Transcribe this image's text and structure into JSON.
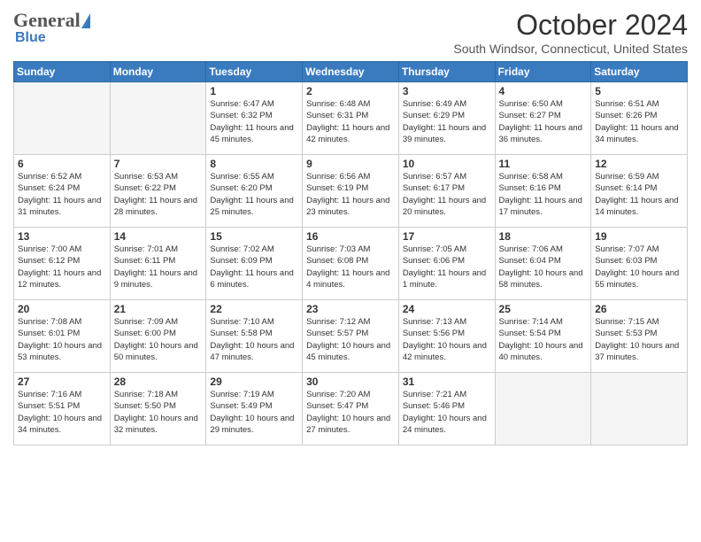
{
  "header": {
    "logo_general": "General",
    "logo_blue": "Blue",
    "month_title": "October 2024",
    "location": "South Windsor, Connecticut, United States"
  },
  "weekdays": [
    "Sunday",
    "Monday",
    "Tuesday",
    "Wednesday",
    "Thursday",
    "Friday",
    "Saturday"
  ],
  "weeks": [
    [
      {
        "num": "",
        "sunrise": "",
        "sunset": "",
        "daylight": ""
      },
      {
        "num": "",
        "sunrise": "",
        "sunset": "",
        "daylight": ""
      },
      {
        "num": "1",
        "sunrise": "Sunrise: 6:47 AM",
        "sunset": "Sunset: 6:32 PM",
        "daylight": "Daylight: 11 hours and 45 minutes."
      },
      {
        "num": "2",
        "sunrise": "Sunrise: 6:48 AM",
        "sunset": "Sunset: 6:31 PM",
        "daylight": "Daylight: 11 hours and 42 minutes."
      },
      {
        "num": "3",
        "sunrise": "Sunrise: 6:49 AM",
        "sunset": "Sunset: 6:29 PM",
        "daylight": "Daylight: 11 hours and 39 minutes."
      },
      {
        "num": "4",
        "sunrise": "Sunrise: 6:50 AM",
        "sunset": "Sunset: 6:27 PM",
        "daylight": "Daylight: 11 hours and 36 minutes."
      },
      {
        "num": "5",
        "sunrise": "Sunrise: 6:51 AM",
        "sunset": "Sunset: 6:26 PM",
        "daylight": "Daylight: 11 hours and 34 minutes."
      }
    ],
    [
      {
        "num": "6",
        "sunrise": "Sunrise: 6:52 AM",
        "sunset": "Sunset: 6:24 PM",
        "daylight": "Daylight: 11 hours and 31 minutes."
      },
      {
        "num": "7",
        "sunrise": "Sunrise: 6:53 AM",
        "sunset": "Sunset: 6:22 PM",
        "daylight": "Daylight: 11 hours and 28 minutes."
      },
      {
        "num": "8",
        "sunrise": "Sunrise: 6:55 AM",
        "sunset": "Sunset: 6:20 PM",
        "daylight": "Daylight: 11 hours and 25 minutes."
      },
      {
        "num": "9",
        "sunrise": "Sunrise: 6:56 AM",
        "sunset": "Sunset: 6:19 PM",
        "daylight": "Daylight: 11 hours and 23 minutes."
      },
      {
        "num": "10",
        "sunrise": "Sunrise: 6:57 AM",
        "sunset": "Sunset: 6:17 PM",
        "daylight": "Daylight: 11 hours and 20 minutes."
      },
      {
        "num": "11",
        "sunrise": "Sunrise: 6:58 AM",
        "sunset": "Sunset: 6:16 PM",
        "daylight": "Daylight: 11 hours and 17 minutes."
      },
      {
        "num": "12",
        "sunrise": "Sunrise: 6:59 AM",
        "sunset": "Sunset: 6:14 PM",
        "daylight": "Daylight: 11 hours and 14 minutes."
      }
    ],
    [
      {
        "num": "13",
        "sunrise": "Sunrise: 7:00 AM",
        "sunset": "Sunset: 6:12 PM",
        "daylight": "Daylight: 11 hours and 12 minutes."
      },
      {
        "num": "14",
        "sunrise": "Sunrise: 7:01 AM",
        "sunset": "Sunset: 6:11 PM",
        "daylight": "Daylight: 11 hours and 9 minutes."
      },
      {
        "num": "15",
        "sunrise": "Sunrise: 7:02 AM",
        "sunset": "Sunset: 6:09 PM",
        "daylight": "Daylight: 11 hours and 6 minutes."
      },
      {
        "num": "16",
        "sunrise": "Sunrise: 7:03 AM",
        "sunset": "Sunset: 6:08 PM",
        "daylight": "Daylight: 11 hours and 4 minutes."
      },
      {
        "num": "17",
        "sunrise": "Sunrise: 7:05 AM",
        "sunset": "Sunset: 6:06 PM",
        "daylight": "Daylight: 11 hours and 1 minute."
      },
      {
        "num": "18",
        "sunrise": "Sunrise: 7:06 AM",
        "sunset": "Sunset: 6:04 PM",
        "daylight": "Daylight: 10 hours and 58 minutes."
      },
      {
        "num": "19",
        "sunrise": "Sunrise: 7:07 AM",
        "sunset": "Sunset: 6:03 PM",
        "daylight": "Daylight: 10 hours and 55 minutes."
      }
    ],
    [
      {
        "num": "20",
        "sunrise": "Sunrise: 7:08 AM",
        "sunset": "Sunset: 6:01 PM",
        "daylight": "Daylight: 10 hours and 53 minutes."
      },
      {
        "num": "21",
        "sunrise": "Sunrise: 7:09 AM",
        "sunset": "Sunset: 6:00 PM",
        "daylight": "Daylight: 10 hours and 50 minutes."
      },
      {
        "num": "22",
        "sunrise": "Sunrise: 7:10 AM",
        "sunset": "Sunset: 5:58 PM",
        "daylight": "Daylight: 10 hours and 47 minutes."
      },
      {
        "num": "23",
        "sunrise": "Sunrise: 7:12 AM",
        "sunset": "Sunset: 5:57 PM",
        "daylight": "Daylight: 10 hours and 45 minutes."
      },
      {
        "num": "24",
        "sunrise": "Sunrise: 7:13 AM",
        "sunset": "Sunset: 5:56 PM",
        "daylight": "Daylight: 10 hours and 42 minutes."
      },
      {
        "num": "25",
        "sunrise": "Sunrise: 7:14 AM",
        "sunset": "Sunset: 5:54 PM",
        "daylight": "Daylight: 10 hours and 40 minutes."
      },
      {
        "num": "26",
        "sunrise": "Sunrise: 7:15 AM",
        "sunset": "Sunset: 5:53 PM",
        "daylight": "Daylight: 10 hours and 37 minutes."
      }
    ],
    [
      {
        "num": "27",
        "sunrise": "Sunrise: 7:16 AM",
        "sunset": "Sunset: 5:51 PM",
        "daylight": "Daylight: 10 hours and 34 minutes."
      },
      {
        "num": "28",
        "sunrise": "Sunrise: 7:18 AM",
        "sunset": "Sunset: 5:50 PM",
        "daylight": "Daylight: 10 hours and 32 minutes."
      },
      {
        "num": "29",
        "sunrise": "Sunrise: 7:19 AM",
        "sunset": "Sunset: 5:49 PM",
        "daylight": "Daylight: 10 hours and 29 minutes."
      },
      {
        "num": "30",
        "sunrise": "Sunrise: 7:20 AM",
        "sunset": "Sunset: 5:47 PM",
        "daylight": "Daylight: 10 hours and 27 minutes."
      },
      {
        "num": "31",
        "sunrise": "Sunrise: 7:21 AM",
        "sunset": "Sunset: 5:46 PM",
        "daylight": "Daylight: 10 hours and 24 minutes."
      },
      {
        "num": "",
        "sunrise": "",
        "sunset": "",
        "daylight": ""
      },
      {
        "num": "",
        "sunrise": "",
        "sunset": "",
        "daylight": ""
      }
    ]
  ]
}
